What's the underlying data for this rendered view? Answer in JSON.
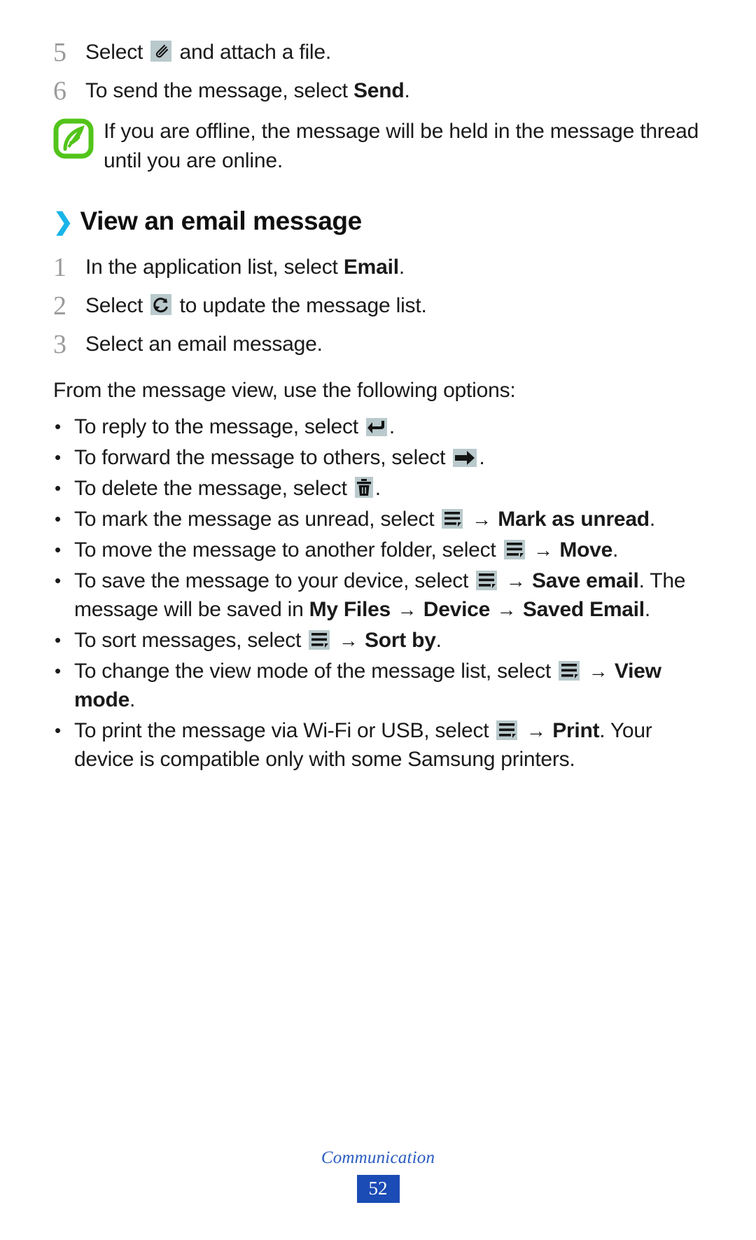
{
  "steps_top": [
    {
      "number": "5",
      "parts": [
        {
          "type": "text",
          "value": "Select "
        },
        {
          "type": "icon",
          "value": "attachment-icon"
        },
        {
          "type": "text",
          "value": " and attach a file."
        }
      ]
    },
    {
      "number": "6",
      "parts": [
        {
          "type": "text",
          "value": "To send the message, select "
        },
        {
          "type": "bold",
          "value": "Send"
        },
        {
          "type": "text",
          "value": "."
        }
      ]
    }
  ],
  "note": {
    "icon": "note-leaf-icon",
    "icon_color": "#52c41a",
    "text": "If you are offline, the message will be held in the message thread until you are online."
  },
  "section": {
    "chevron": "double-chevron-right",
    "chevron_color": "#19b4e8",
    "title": "View an email message"
  },
  "steps_section": [
    {
      "number": "1",
      "parts": [
        {
          "type": "text",
          "value": "In the application list, select "
        },
        {
          "type": "bold",
          "value": "Email"
        },
        {
          "type": "text",
          "value": "."
        }
      ]
    },
    {
      "number": "2",
      "parts": [
        {
          "type": "text",
          "value": "Select "
        },
        {
          "type": "icon",
          "value": "refresh-icon"
        },
        {
          "type": "text",
          "value": " to update the message list."
        }
      ]
    },
    {
      "number": "3",
      "parts": [
        {
          "type": "text",
          "value": "Select an email message."
        }
      ]
    }
  ],
  "intro_paragraph": "From the message view, use the following options:",
  "bullets": [
    {
      "bullet": "•",
      "parts": [
        {
          "type": "text",
          "value": "To reply to the message, select "
        },
        {
          "type": "icon",
          "value": "reply-arrow-icon"
        },
        {
          "type": "text",
          "value": "."
        }
      ]
    },
    {
      "bullet": "•",
      "parts": [
        {
          "type": "text",
          "value": "To forward the message to others, select "
        },
        {
          "type": "icon",
          "value": "forward-arrow-icon"
        },
        {
          "type": "text",
          "value": "."
        }
      ]
    },
    {
      "bullet": "•",
      "parts": [
        {
          "type": "text",
          "value": "To delete the message, select "
        },
        {
          "type": "icon",
          "value": "trash-icon"
        },
        {
          "type": "text",
          "value": "."
        }
      ]
    },
    {
      "bullet": "•",
      "parts": [
        {
          "type": "text",
          "value": "To mark the message as unread, select "
        },
        {
          "type": "icon",
          "value": "menu-options-icon"
        },
        {
          "type": "arrow",
          "value": "→"
        },
        {
          "type": "bold",
          "value": "Mark as unread"
        },
        {
          "type": "text",
          "value": "."
        }
      ]
    },
    {
      "bullet": "•",
      "parts": [
        {
          "type": "text",
          "value": "To move the message to another folder, select "
        },
        {
          "type": "icon",
          "value": "menu-options-icon"
        },
        {
          "type": "arrow",
          "value": "→"
        },
        {
          "type": "bold",
          "value": "Move"
        },
        {
          "type": "text",
          "value": "."
        }
      ]
    },
    {
      "bullet": "•",
      "parts": [
        {
          "type": "text",
          "value": "To save the message to your device, select "
        },
        {
          "type": "icon",
          "value": "menu-options-icon"
        },
        {
          "type": "arrow",
          "value": "→"
        },
        {
          "type": "bold",
          "value": "Save email"
        },
        {
          "type": "text",
          "value": ". The message will be saved in "
        },
        {
          "type": "bold",
          "value": "My Files"
        },
        {
          "type": "arrow",
          "value": "→"
        },
        {
          "type": "bold",
          "value": "Device"
        },
        {
          "type": "arrow",
          "value": "→"
        },
        {
          "type": "bold",
          "value": "Saved Email"
        },
        {
          "type": "text",
          "value": "."
        }
      ]
    },
    {
      "bullet": "•",
      "parts": [
        {
          "type": "text",
          "value": "To sort messages, select "
        },
        {
          "type": "icon",
          "value": "menu-options-icon"
        },
        {
          "type": "arrow",
          "value": "→"
        },
        {
          "type": "bold",
          "value": "Sort by"
        },
        {
          "type": "text",
          "value": "."
        }
      ]
    },
    {
      "bullet": "•",
      "parts": [
        {
          "type": "text",
          "value": "To change the view mode of the message list, select "
        },
        {
          "type": "icon",
          "value": "menu-options-icon"
        },
        {
          "type": "arrow",
          "value": "→"
        },
        {
          "type": "bold",
          "value": "View mode"
        },
        {
          "type": "text",
          "value": "."
        }
      ]
    },
    {
      "bullet": "•",
      "parts": [
        {
          "type": "text",
          "value": "To print the message via Wi-Fi or USB, select "
        },
        {
          "type": "icon",
          "value": "menu-options-icon"
        },
        {
          "type": "arrow",
          "value": "→"
        },
        {
          "type": "bold",
          "value": "Print"
        },
        {
          "type": "text",
          "value": ". Your device is compatible only with some Samsung printers."
        }
      ]
    }
  ],
  "footer": {
    "chapter": "Communication",
    "page_number": "52",
    "chapter_color": "#2a5bc0",
    "badge_color": "#1b4bb5"
  }
}
